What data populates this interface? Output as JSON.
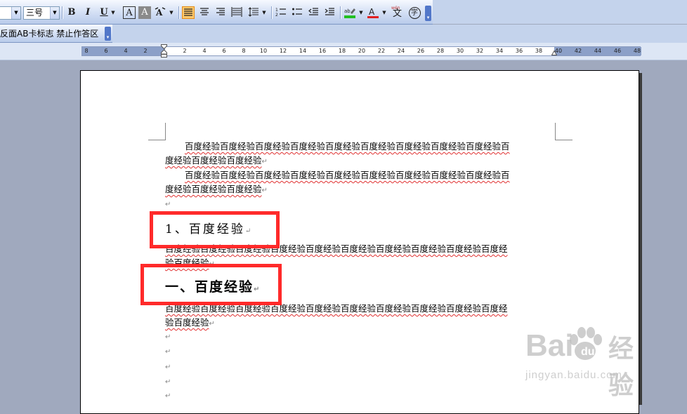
{
  "toolbar": {
    "font_size_value": "三号",
    "bold": "B",
    "italic": "I",
    "underline": "U",
    "char_border": "A",
    "char_shading": "A",
    "char_scale": "A",
    "chinese_layout": "wén",
    "chinese_layout_char": "文",
    "enclosed_char": "字",
    "highlight_colors": {
      "highlight": "#22c020",
      "font_color": "#e02020",
      "active": "#ffc96b"
    }
  },
  "toolbar2": {
    "text": "反面AB卡标志  禁止作答区"
  },
  "ruler": {
    "ticks": [
      "8",
      "6",
      "4",
      "2",
      "2",
      "4",
      "6",
      "8",
      "10",
      "12",
      "14",
      "16",
      "18",
      "20",
      "22",
      "24",
      "26",
      "28",
      "30",
      "32",
      "34",
      "36",
      "38",
      "40",
      "42",
      "44",
      "46",
      "48"
    ]
  },
  "document": {
    "paragraphs": [
      {
        "line1": "百度经验百度经验百度经验百度经验百度经验百度经验百度经验百度经验百度经验百",
        "line2": "度经验百度经验百度经验"
      },
      {
        "line1": "百度经验百度经验百度经验百度经验百度经验百度经验百度经验百度经验百度经验百",
        "line2": "度经验百度经验百度经验"
      },
      {
        "line1": "百度经验百度经验百度经验百度经验百度经验百度经验百度经验百度经验百度经验百度经",
        "line2": "验百度经验"
      },
      {
        "line1": "百度经验百度经验百度经验百度经验百度经验百度经验百度经验百度经验百度经验百度经",
        "line2": "验百度经验"
      }
    ],
    "heading1": "1、百度经验",
    "heading2": "一、百度经验",
    "paragraph_mark": "↵"
  },
  "watermark": {
    "logo_text": "Bai",
    "logo_text2": "经验",
    "url": "jingyan.baidu.com"
  }
}
